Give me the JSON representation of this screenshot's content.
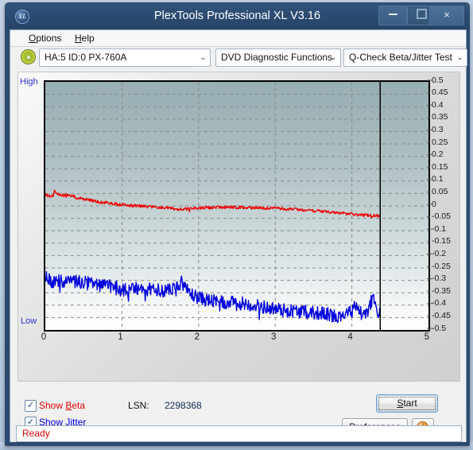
{
  "window": {
    "title": "PlexTools Professional XL V3.16",
    "app_icon": "XL",
    "controls": {
      "minimize": "minimize-icon",
      "maximize": "maximize-icon",
      "close": "×"
    }
  },
  "menubar": {
    "items": [
      {
        "label": "Options",
        "accel": "O"
      },
      {
        "label": "Help",
        "accel": "H"
      }
    ]
  },
  "toolbar": {
    "disc_icon": "disc-icon",
    "drive": {
      "value": "HA:5 ID:0  PX-760A",
      "arrow": "⌄"
    },
    "function": {
      "value": "DVD Diagnostic Functions",
      "arrow": "⌄"
    },
    "test": {
      "value": "Q-Check Beta/Jitter Test",
      "arrow": "⌄"
    }
  },
  "chart_data": {
    "type": "line",
    "title": "Q-Check Beta/Jitter Test",
    "xlabel": "",
    "ylabel": "",
    "axis_side_labels": {
      "top": "High",
      "bottom": "Low"
    },
    "xlim": [
      0,
      5
    ],
    "ylim": [
      -0.5,
      0.5
    ],
    "xticks": [
      0,
      1,
      2,
      3,
      4,
      5
    ],
    "ytick_labels": [
      "0.5",
      "0.45",
      "0.4",
      "0.35",
      "0.3",
      "0.25",
      "0.2",
      "0.15",
      "0.1",
      "0.05",
      "0",
      "-0.05",
      "-0.1",
      "-0.15",
      "-0.2",
      "-0.25",
      "-0.3",
      "-0.35",
      "-0.4",
      "-0.45",
      "-0.5"
    ],
    "yticks": [
      0.5,
      0.45,
      0.4,
      0.35,
      0.3,
      0.25,
      0.2,
      0.15,
      0.1,
      0.05,
      0,
      -0.05,
      -0.1,
      -0.15,
      -0.2,
      -0.25,
      -0.3,
      -0.35,
      -0.4,
      -0.45,
      -0.5
    ],
    "grid": true,
    "grid_style": "dashed",
    "data_end_x": 4.37,
    "legend_position": "below-plot",
    "series": [
      {
        "name": "Beta",
        "color": "#ee0000",
        "x": [
          0.0,
          0.05,
          0.1,
          0.12,
          0.15,
          0.2,
          0.25,
          0.3,
          0.35,
          0.4,
          0.5,
          0.6,
          0.7,
          0.8,
          0.9,
          1.0,
          1.1,
          1.2,
          1.3,
          1.4,
          1.5,
          1.6,
          1.7,
          1.75,
          1.8,
          1.9,
          2.0,
          2.1,
          2.2,
          2.3,
          2.4,
          2.5,
          2.6,
          2.7,
          2.8,
          2.9,
          3.0,
          3.1,
          3.2,
          3.3,
          3.4,
          3.5,
          3.6,
          3.7,
          3.8,
          3.9,
          4.0,
          4.1,
          4.2,
          4.3,
          4.37
        ],
        "y": [
          0.045,
          0.04,
          0.038,
          0.062,
          0.05,
          0.044,
          0.042,
          0.045,
          0.04,
          0.034,
          0.028,
          0.022,
          0.016,
          0.012,
          0.008,
          0.005,
          0.002,
          0.0,
          -0.002,
          -0.004,
          -0.006,
          -0.008,
          -0.012,
          -0.014,
          -0.012,
          -0.01,
          -0.008,
          -0.007,
          -0.006,
          -0.005,
          -0.005,
          -0.006,
          -0.006,
          -0.007,
          -0.008,
          -0.009,
          -0.01,
          -0.011,
          -0.013,
          -0.015,
          -0.017,
          -0.019,
          -0.021,
          -0.024,
          -0.027,
          -0.03,
          -0.033,
          -0.035,
          -0.037,
          -0.039,
          -0.04
        ],
        "noise": 0.006
      },
      {
        "name": "Jitter",
        "color": "#0000dd",
        "x": [
          0.0,
          0.05,
          0.1,
          0.15,
          0.2,
          0.3,
          0.4,
          0.5,
          0.6,
          0.7,
          0.8,
          0.9,
          1.0,
          1.1,
          1.2,
          1.3,
          1.4,
          1.5,
          1.6,
          1.7,
          1.78,
          1.82,
          1.9,
          2.0,
          2.1,
          2.2,
          2.3,
          2.4,
          2.5,
          2.6,
          2.7,
          2.8,
          2.9,
          3.0,
          3.1,
          3.2,
          3.3,
          3.4,
          3.5,
          3.6,
          3.7,
          3.8,
          3.9,
          4.0,
          4.05,
          4.1,
          4.2,
          4.28,
          4.32,
          4.37
        ],
        "y": [
          -0.285,
          -0.3,
          -0.305,
          -0.3,
          -0.305,
          -0.3,
          -0.305,
          -0.31,
          -0.315,
          -0.32,
          -0.322,
          -0.325,
          -0.34,
          -0.338,
          -0.335,
          -0.335,
          -0.338,
          -0.34,
          -0.342,
          -0.338,
          -0.3,
          -0.33,
          -0.355,
          -0.37,
          -0.378,
          -0.385,
          -0.39,
          -0.392,
          -0.39,
          -0.392,
          -0.398,
          -0.405,
          -0.41,
          -0.415,
          -0.42,
          -0.422,
          -0.425,
          -0.428,
          -0.43,
          -0.432,
          -0.438,
          -0.445,
          -0.432,
          -0.428,
          -0.395,
          -0.43,
          -0.435,
          -0.362,
          -0.43,
          -0.435
        ],
        "noise": 0.028
      }
    ]
  },
  "controls_panel": {
    "show_beta": {
      "label": "Show Beta",
      "accel": "B",
      "checked": true,
      "check_glyph": "✓"
    },
    "show_jitter": {
      "label": "Show Jitter",
      "accel": "J",
      "checked": true,
      "check_glyph": "✓"
    },
    "lsn_label": "LSN:",
    "lsn_value": "2298368",
    "start_button": {
      "label": "Start",
      "accel": "S"
    },
    "preferences_button": {
      "label": "Preferences",
      "accel": "P"
    },
    "info_button": {
      "label": "i"
    }
  },
  "statusbar": {
    "text": "Ready"
  }
}
